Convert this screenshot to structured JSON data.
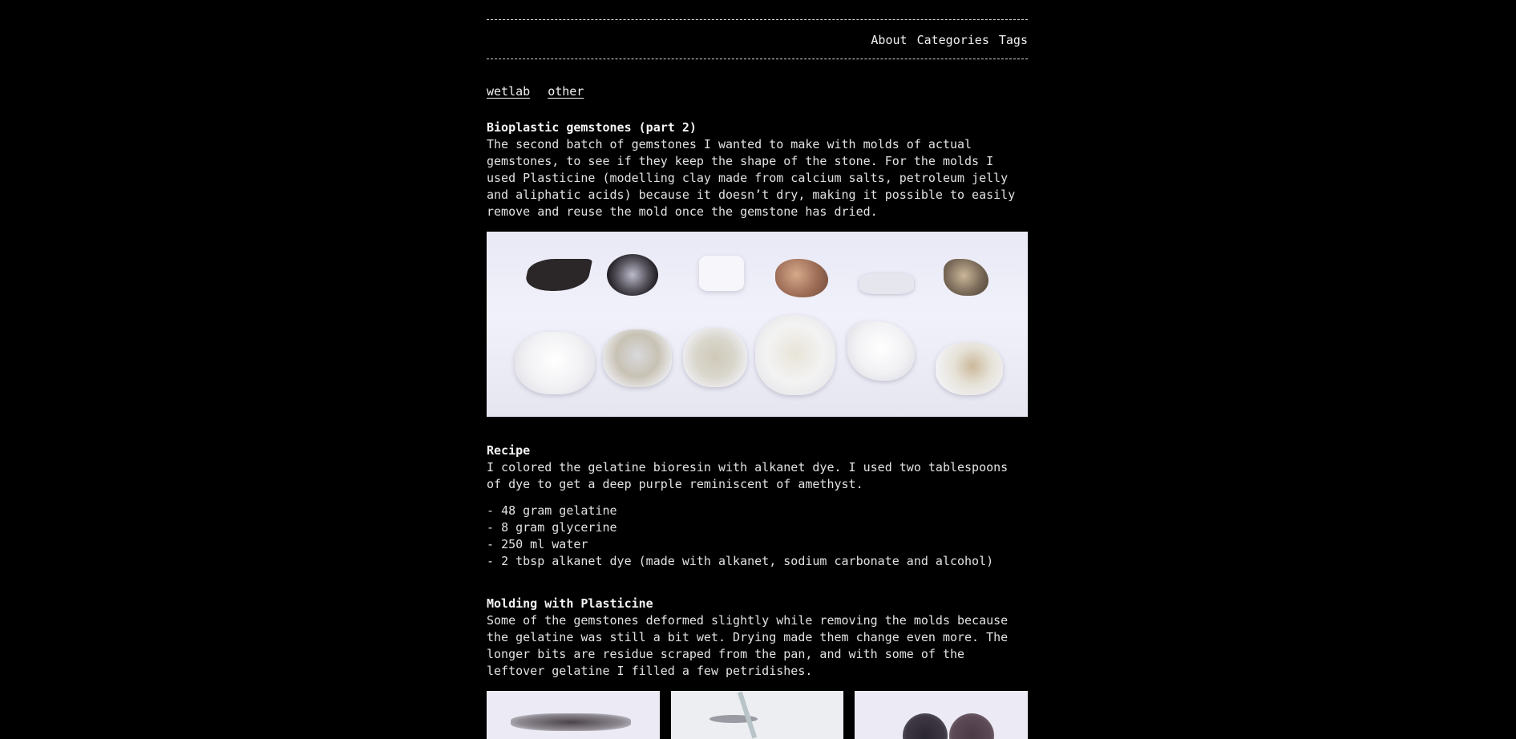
{
  "nav": {
    "items": [
      "About",
      "Categories",
      "Tags"
    ]
  },
  "categories": [
    "wetlab",
    "other"
  ],
  "post": {
    "title": "Bioplastic gemstones (part 2)",
    "intro": "The second batch of gemstones I wanted to make with molds of actual gemstones, to see if they keep the shape of the stone. For the molds I used Plasticine (modelling clay made from calcium salts, petroleum jelly and aliphatic acids) because it doesn’t dry, making it possible to easily remove and reuse the mold once the gemstone has dried."
  },
  "recipe": {
    "heading": "Recipe",
    "text": "I colored the gelatine bioresin with alkanet dye. I used two tablespoons of dye to get a deep purple reminiscent of amethyst.",
    "ingredients": [
      "48 gram gelatine",
      "8 gram glycerine",
      "250 ml water",
      "2 tbsp alkanet dye (made with alkanet, sodium carbonate and alcohol)"
    ]
  },
  "molding": {
    "heading": "Molding with Plasticine",
    "text": "Some of the gemstones deformed slightly while removing the molds because the gelatine was still a bit wet. Drying made them change even more. The longer bits are residue scraped from the pan, and with some of the leftover gelatine I filled a few petridishes."
  }
}
